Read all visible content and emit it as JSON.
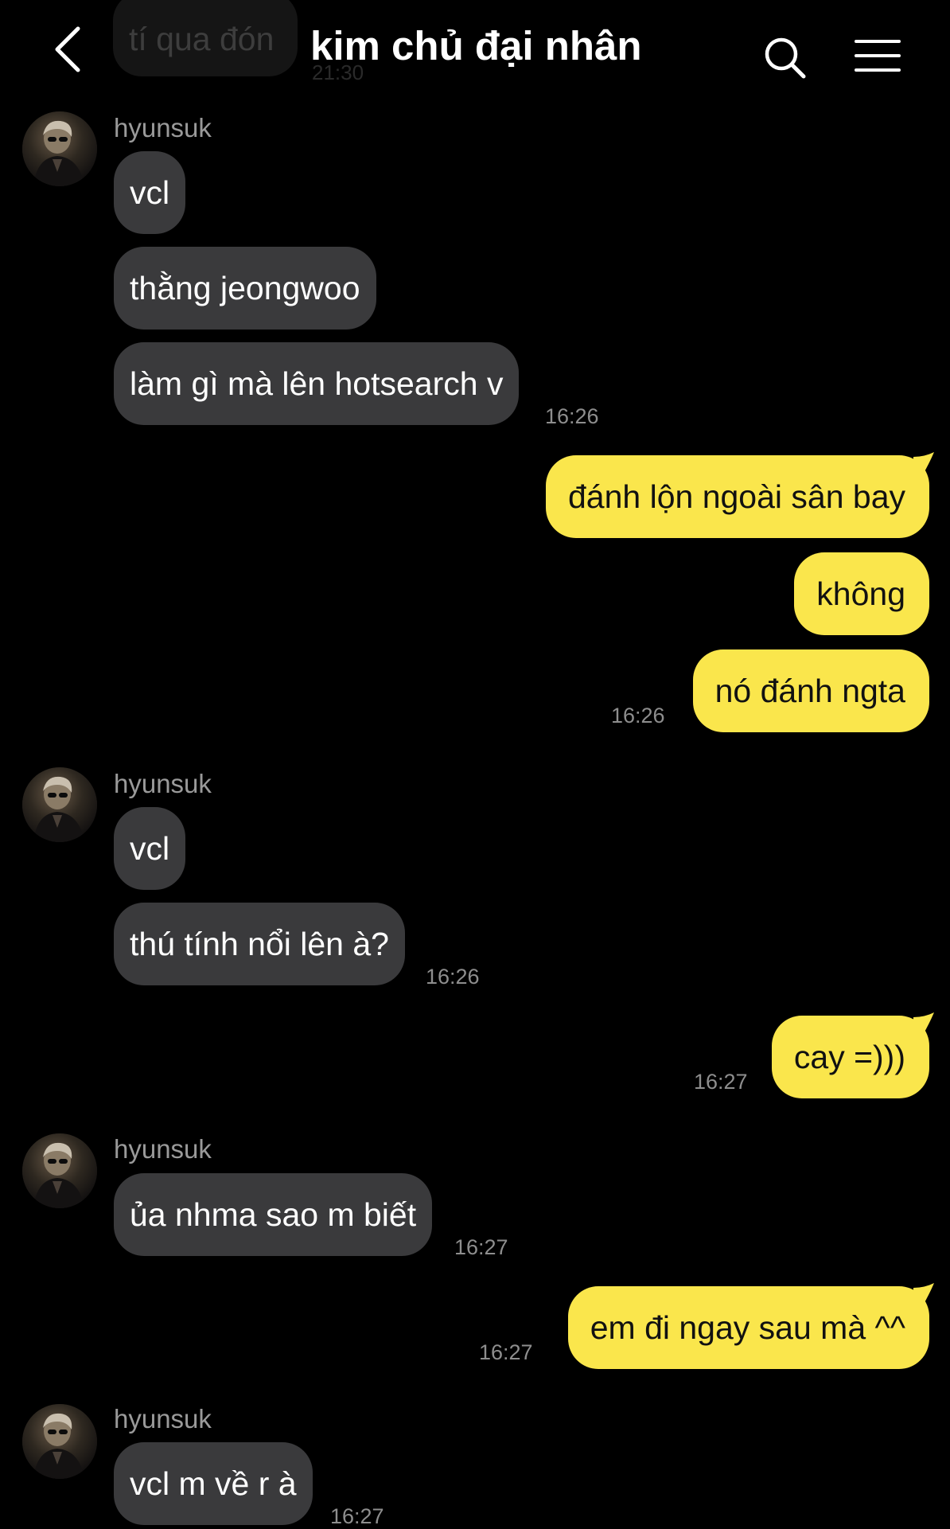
{
  "header": {
    "title": "kim chủ đại nhân",
    "back_icon": "chevron-left-icon",
    "search_icon": "search-icon",
    "menu_icon": "menu-icon"
  },
  "previous_message": {
    "text": "tí qua đón",
    "time": "21:30"
  },
  "colors": {
    "background": "#000000",
    "incoming_bubble": "#3a3a3c",
    "outgoing_bubble": "#fae64c",
    "timestamp": "#8e8e8e",
    "sender_name": "#9a9a9a"
  },
  "messages": {
    "g1": {
      "sender": "hyunsuk",
      "m1": "vcl",
      "m2": "thằng jeongwoo",
      "m3": "làm gì mà lên hotsearch v",
      "time": "16:26"
    },
    "g2": {
      "m1": "đánh lộn ngoài sân bay",
      "m2": "không",
      "m3": "nó đánh ngta",
      "time": "16:26"
    },
    "g3": {
      "sender": "hyunsuk",
      "m1": "vcl",
      "m2": "thú tính nổi lên à?",
      "time": "16:26"
    },
    "g4": {
      "m1": "cay =)))",
      "time": "16:27"
    },
    "g5": {
      "sender": "hyunsuk",
      "m1": "ủa nhma sao m biết",
      "time": "16:27"
    },
    "g6": {
      "m1": "em đi ngay sau mà ^^",
      "time": "16:27"
    },
    "g7": {
      "sender": "hyunsuk",
      "m1": "vcl m về r à",
      "time": "16:27"
    }
  }
}
